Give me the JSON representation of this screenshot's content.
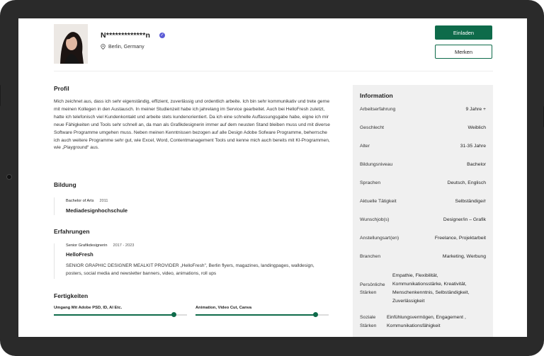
{
  "header": {
    "name": "N*************n",
    "location": "Berlin, Germany",
    "primary_button": "Einladen",
    "secondary_button": "Merken"
  },
  "profil": {
    "heading": "Profil",
    "text": "Mich zeichnet aus, dass ich sehr eigenständig, effizient, zuverlässig und ordentlich arbeite. Ich bin sehr kommunikativ und trete gerne mit meinen Kollegen in den Austausch. In meiner Studienzeit habe ich jahrelang im Service gearbeitet. Auch bei HelloFresh zuletzt, hatte ich telefonisch viel Kundenkontakt und arbeite stets kundenorientiert. Da ich eine schnelle Auffassungsgabe habe, eigne ich mir neue Fähigkeiten und Tools sehr schnell an, da man als Grafikdesignerin immer auf dem neusten Stand bleiben muss und mit diverse Software Programme umgehen muss. Neben meinen Kenntnissen bezogen auf alle Design Adobe Sofware Programme, beherrsche ich auch weitere Programme sehr gut, wie Excel, Word, Contentmanagement Tools und kenne mich auch bereits mit KI-Programmen, wie „Playground“ aus."
  },
  "bildung": {
    "heading": "Bildung",
    "degree": "Bachelor of Arts",
    "year": "2011",
    "school": "Mediadesignhochschule"
  },
  "erfahrungen": {
    "heading": "Erfahrungen",
    "role": "Senior Grafikdesignerin",
    "dates": "2017 - 2023",
    "company": "HelloFresh",
    "description": "SENIOR GRAPHIC DESIGNER MEALKIT PROVIDER „HelloFresh\", Berlin flyers, magazines, landingpages, walldesign, posters, social media and newsletter banners, video, animations, roll ups"
  },
  "fertigkeiten": {
    "heading": "Fertigkeiten",
    "skills": [
      {
        "label": "Umgang Mit Adobe PSD, ID, AI Etc.",
        "level": 0.9
      },
      {
        "label": "Animation, Video Cut, Canva",
        "level": 0.9
      }
    ]
  },
  "information": {
    "title": "Information",
    "rows": [
      {
        "label": "Arbeitserfahrung",
        "value": "9 Jahre +"
      },
      {
        "label": "Geschlecht",
        "value": "Weiblich"
      },
      {
        "label": "Alter",
        "value": "31-35 Jahre"
      },
      {
        "label": "Bildungsniveau",
        "value": "Bachelor"
      },
      {
        "label": "Sprachen",
        "value": "Deutsch, Englisch"
      },
      {
        "label": "Aktuelle Tätigkeit",
        "value": "Selbständige/r"
      },
      {
        "label": "Wunschjob(s)",
        "value": "Designer/in – Grafik"
      },
      {
        "label": "Anstellungsart(en)",
        "value": "Freelance, Projektarbeit"
      },
      {
        "label": "Branchen",
        "value": "Marketing, Werbung"
      }
    ],
    "persoenliche": {
      "label": "Persönliche Stärken",
      "value": "Empathie, Flexibilität, Kommunikationsstärke, Kreativität, Menschenkenntnis, Selbständigkeit, Zuverlässigkeit"
    },
    "soziale": {
      "label": "Soziale Stärken",
      "value": "Einfühlungsvermögen, Engagement , Kommunikationsfähigkeit"
    }
  },
  "colors": {
    "accent": "#0e6b4a",
    "panel": "#f0f0f0",
    "device": "#2a2a2a"
  }
}
